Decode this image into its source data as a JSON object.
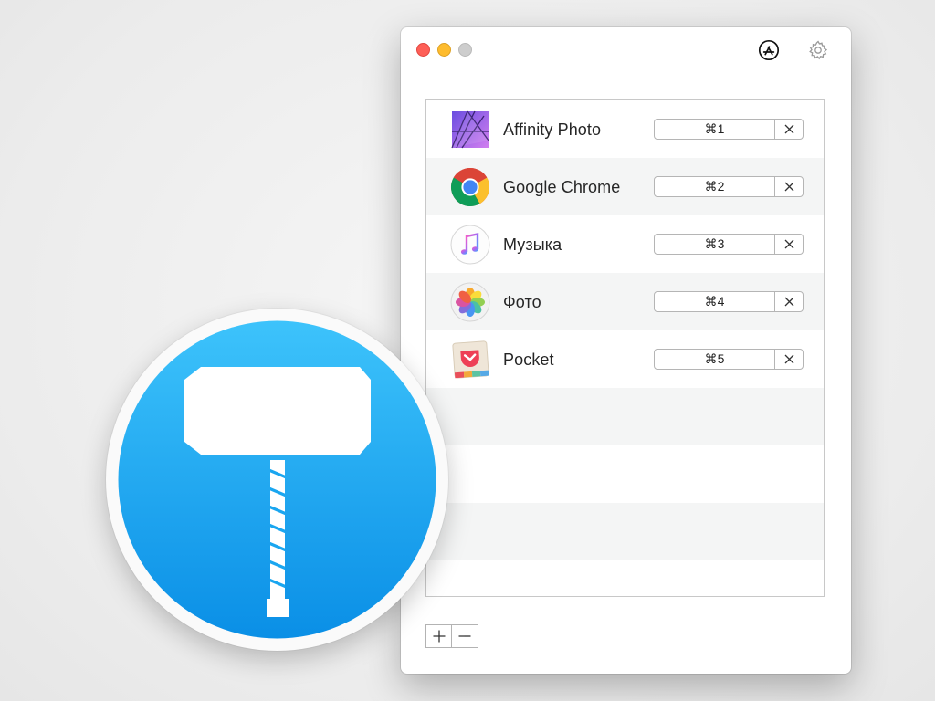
{
  "window": {
    "icons": {
      "app_store": "app-store-icon",
      "settings": "gear-icon"
    }
  },
  "apps": [
    {
      "name": "Affinity Photo",
      "shortcut": "⌘1",
      "icon": "affinity-photo-icon"
    },
    {
      "name": "Google Chrome",
      "shortcut": "⌘2",
      "icon": "google-chrome-icon"
    },
    {
      "name": "Музыка",
      "shortcut": "⌘3",
      "icon": "music-icon"
    },
    {
      "name": "Фото",
      "shortcut": "⌘4",
      "icon": "photos-icon"
    },
    {
      "name": "Pocket",
      "shortcut": "⌘5",
      "icon": "pocket-icon"
    }
  ],
  "list_controls": {
    "add": "plus-icon",
    "remove": "minus-icon"
  },
  "colors": {
    "logo_blue_top": "#3dc3fb",
    "logo_blue_bottom": "#0a8fe6",
    "close": "#fe5f57",
    "minimize": "#febc2e",
    "zoom": "#cdcdcd"
  },
  "logo": {
    "icon": "hammer-icon"
  }
}
